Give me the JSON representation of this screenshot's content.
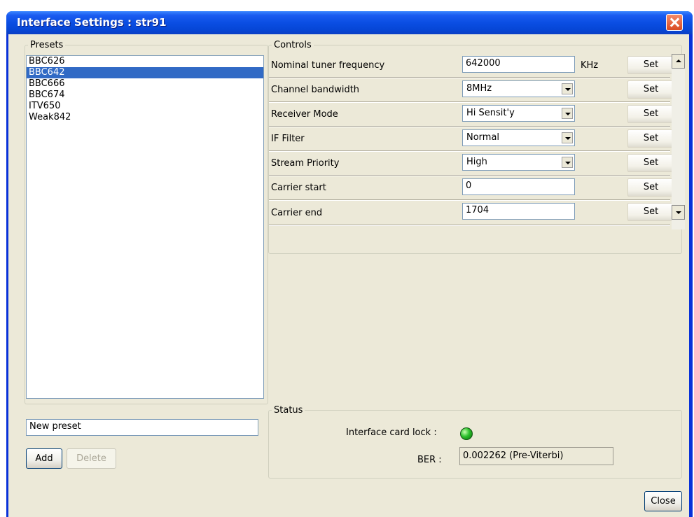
{
  "window": {
    "title": "Interface Settings : str91"
  },
  "presets": {
    "legend": "Presets",
    "items": [
      "BBC626",
      "BBC642",
      "BBC666",
      "BBC674",
      "ITV650",
      "Weak842"
    ],
    "selected": "BBC642",
    "new_name_value": "New preset",
    "add_label": "Add",
    "delete_label": "Delete"
  },
  "controls": {
    "legend": "Controls",
    "set_label": "Set",
    "rows": [
      {
        "label": "Nominal tuner frequency",
        "value": "642000",
        "unit": "KHz"
      },
      {
        "label": "Channel bandwidth",
        "value": "8MHz"
      },
      {
        "label": "Receiver Mode",
        "value": "Hi Sensit'y"
      },
      {
        "label": "IF Filter",
        "value": "Normal"
      },
      {
        "label": "Stream Priority",
        "value": "High"
      },
      {
        "label": "Carrier start",
        "value": "0"
      },
      {
        "label": "Carrier end",
        "value": "1704"
      }
    ]
  },
  "status": {
    "legend": "Status",
    "lock_label": "Interface card lock :",
    "lock_color": "#2cc02c",
    "ber_label": "BER :",
    "ber_value": "0.002262  (Pre-Viterbi)"
  },
  "footer": {
    "close_label": "Close"
  }
}
